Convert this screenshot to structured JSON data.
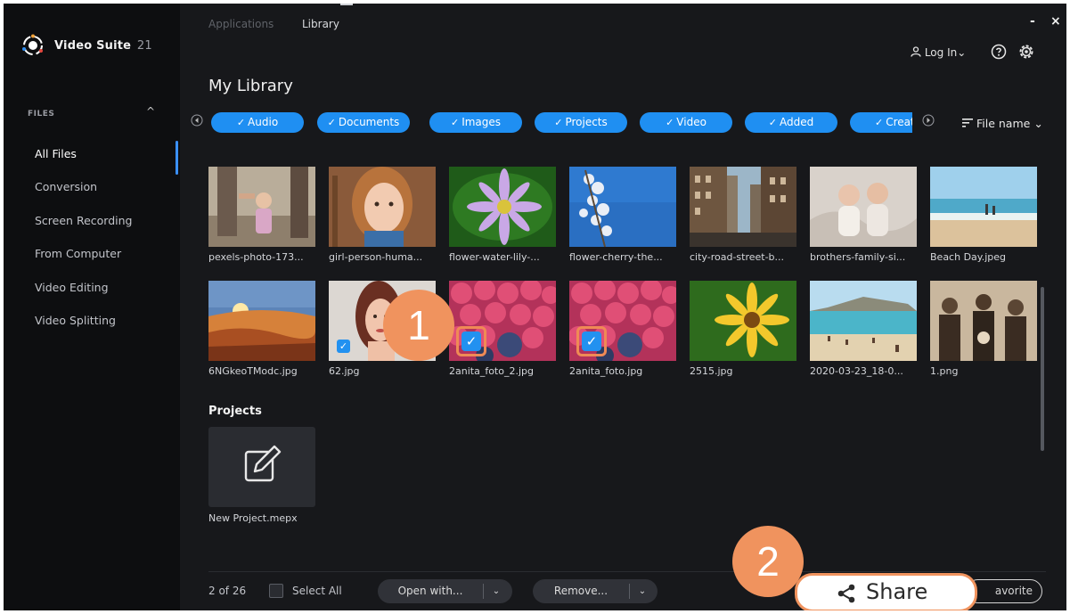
{
  "app": {
    "name": "Video Suite",
    "version": "21"
  },
  "top_tabs": [
    "Applications",
    "Library"
  ],
  "window_controls": {
    "minimize": "-",
    "close": "×"
  },
  "header": {
    "login": "Log In",
    "login_chevron": "⌄",
    "help_icon": "help-circle-icon",
    "settings_icon": "gear-icon"
  },
  "sidebar": {
    "section_label": "FILES",
    "section_chevron": "^",
    "items": [
      "All Files",
      "Conversion",
      "Screen Recording",
      "From Computer",
      "Video Editing",
      "Video Splitting"
    ],
    "active": "All Files",
    "accent": "#3a90ff"
  },
  "page_title": "My Library",
  "filters": {
    "chips": [
      "Audio",
      "Documents",
      "Images",
      "Projects",
      "Video",
      "Added",
      "Creati"
    ],
    "check": "✓",
    "chip_color": "#1f8ff2"
  },
  "sort": {
    "label": "File name",
    "chevron": "⌄"
  },
  "files_row1": [
    "pexels-photo-173...",
    "girl-person-huma...",
    "flower-water-lily-...",
    "flower-cherry-the...",
    "city-road-street-b...",
    "brothers-family-si...",
    "Beach Day.jpeg"
  ],
  "files_row2": [
    "6NGkeoTModc.jpg",
    "62.jpg",
    "2anita_foto_2.jpg",
    "2anita_foto.jpg",
    "2515.jpg",
    "2020-03-23_18-0...",
    "1.png"
  ],
  "selected_files": [
    "62.jpg",
    "2anita_foto_2.jpg",
    "2anita_foto.jpg"
  ],
  "projects": {
    "title": "Projects",
    "items": [
      "New Project.mepx"
    ]
  },
  "footer": {
    "count": "2 of 26",
    "select_all": "Select All",
    "open_with": "Open with...",
    "remove": "Remove...",
    "favorite": "avorite",
    "share": "Share",
    "dropdown_glyph": "⌄"
  },
  "callouts": [
    "1",
    "2"
  ],
  "callout_color": "#f0935e"
}
